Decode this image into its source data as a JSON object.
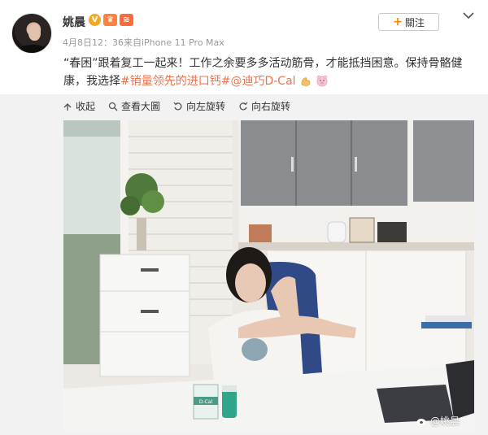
{
  "post": {
    "username": "姚晨",
    "meta": "4月8日12：36来自iPhone 11 Pro Max",
    "follow_label": "關注",
    "text_part1": "“春困”跟着复工一起来！工作之余要多多活动筋骨，才能抵挡困意。保持骨骼健康，我选择",
    "hashtag": "#销量领先的进口钙#",
    "mention": "@迪巧D-Cal"
  },
  "toolbar": {
    "collapse": "收起",
    "view_large": "查看大圖",
    "rotate_left": "向左旋转",
    "rotate_right": "向右旋转"
  },
  "photo": {
    "watermark": "@姚晨",
    "product_label": "D-Cal"
  },
  "colors": {
    "link": "#eb7350",
    "follow_plus": "#ff8200",
    "badge_v": "#f5a623"
  },
  "icons": [
    "more-chevron-icon",
    "collapse-icon",
    "zoom-icon",
    "rotate-left-icon",
    "rotate-right-icon",
    "weibo-logo-icon"
  ]
}
